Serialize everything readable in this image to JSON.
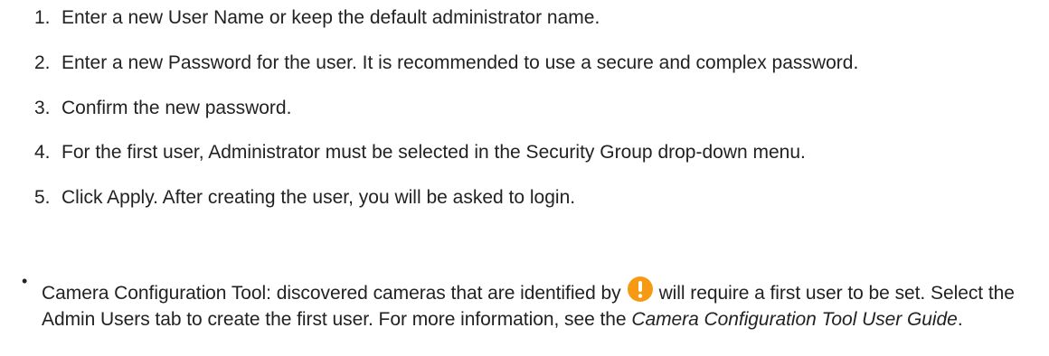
{
  "steps": [
    {
      "number": "1.",
      "text": "Enter a new User Name or keep the default administrator name."
    },
    {
      "number": "2.",
      "text": "Enter a new Password for the user. It is recommended to use a secure and complex password."
    },
    {
      "number": "3.",
      "text": "Confirm the new password."
    },
    {
      "number": "4.",
      "text": "For the first user, Administrator must be selected in the Security Group drop-down menu."
    },
    {
      "number": "5.",
      "text": "Click Apply. After creating the user, you will be asked to login."
    }
  ],
  "bullet": {
    "symbol": "•",
    "text_before_icon": "Camera Configuration Tool: discovered cameras that are identified by",
    "icon": "warning-icon",
    "text_after_icon": "will require a first user to be set. Select the Admin Users tab to create the first user. For more information, see the",
    "guide_name": "Camera Configuration Tool User Guide",
    "trailing_punctuation": "."
  },
  "colors": {
    "text": "#222222",
    "warning_orange": "#f59a12",
    "warning_mark": "#ffffff"
  }
}
